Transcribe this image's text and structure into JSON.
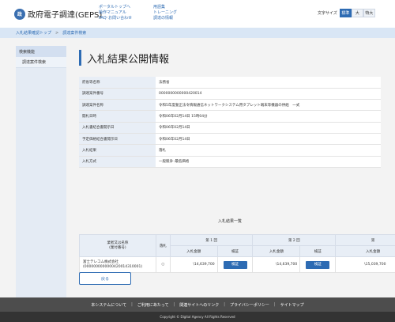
{
  "header": {
    "logo_mark": "政",
    "logo_text": "政府電子調達(GEPS)",
    "nav_col1": [
      "ポータルトップへ",
      "操作マニュアル",
      "FAQ･お問い合わせ"
    ],
    "nav_col2": [
      "用語集",
      "トレーニング",
      "調達の情報"
    ],
    "font_size_label": "文字サイズ",
    "font_sizes": [
      "標準",
      "大",
      "特大"
    ],
    "font_size_selected": "標準"
  },
  "breadcrumb": [
    "入札結果確認トップ",
    "調達案件検索"
  ],
  "sidebar": {
    "heading": "検索機能",
    "items": [
      "調達案件検索"
    ]
  },
  "main": {
    "title": "入札結果公開情報",
    "info": [
      {
        "label": "府省等名称",
        "value": "法務省"
      },
      {
        "label": "調達案件番号",
        "value": "0000000000000420014"
      },
      {
        "label": "調達案件名称",
        "value": "令和5年度誓正法令情報通信ネットワークシステム用タブレット端末等機器の供給　一式"
      },
      {
        "label": "開札日時",
        "value": "令和06年02月14日 15時04分"
      },
      {
        "label": "入札書結合書開示日",
        "value": "令和06年02月14日"
      },
      {
        "label": "予定価格結合書開示日",
        "value": "令和06年02月14日"
      },
      {
        "label": "入札結果",
        "value": "落札"
      },
      {
        "label": "入札方式",
        "value": "一般競争･最低価格"
      }
    ],
    "result_section_title": "入札結果一覧",
    "result_table": {
      "col_company": "業者又は名称\n(業付番号)",
      "col_award": "落札",
      "rounds": [
        "第 1 回",
        "第 2 回",
        "第"
      ],
      "col_amount": "入札金額",
      "col_detail": "検証",
      "rows": [
        {
          "company": "富士テレコム株式会社",
          "company_no": "(0000000000000420014310001)",
          "award": "○",
          "amounts": [
            "\\14,639,700",
            "\\14,639,700",
            "\\15,039,700"
          ],
          "detail_label": "検証"
        }
      ]
    },
    "back_label": "戻る"
  },
  "footer": {
    "links": [
      "本システムについて",
      "ご利用にあたって",
      "関連サイトへのリンク",
      "プライバシーポリシー",
      "サイトマップ"
    ],
    "copyright": "Copyright © Digital Agency All Rights Reserved"
  },
  "colors": {
    "accent": "#2d6bb3",
    "breadcrumb_bg": "#d9e6f5",
    "label_bg": "#e8eef6",
    "footer_bg": "#4d4d4d"
  }
}
